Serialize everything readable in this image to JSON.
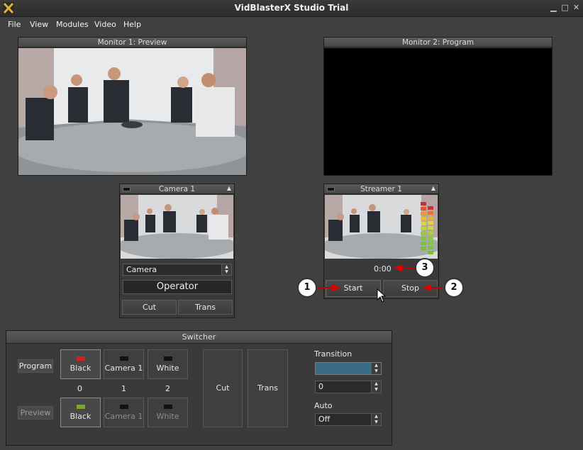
{
  "window": {
    "title": "VidBlasterX Studio Trial"
  },
  "menu": [
    "File",
    "View",
    "Modules",
    "Video",
    "Help"
  ],
  "monitor1": {
    "title": "Monitor 1: Preview"
  },
  "monitor2": {
    "title": "Monitor 2: Program"
  },
  "camera1": {
    "title": "Camera 1",
    "source_select": "Camera",
    "operator": "Operator",
    "cut_label": "Cut",
    "trans_label": "Trans"
  },
  "streamer1": {
    "title": "Streamer 1",
    "time": "0:00",
    "start_label": "Start",
    "stop_label": "Stop"
  },
  "switcher": {
    "title": "Switcher",
    "program_label": "Program",
    "preview_label": "Preview",
    "program_sources": [
      "Black",
      "Camera 1",
      "White"
    ],
    "preview_sources": [
      "Black",
      "Camera 1",
      "White"
    ],
    "indexes": [
      "0",
      "1",
      "2"
    ],
    "cut_label": "Cut",
    "trans_label": "Trans",
    "transition_label": "Transition",
    "transition_value": "",
    "duration_value": "0",
    "auto_label": "Auto",
    "auto_value": "Off",
    "colors": {
      "program_led": "#d42020",
      "preview_led": "#7aa828",
      "transition_fill": "#3b6c87"
    }
  },
  "callouts": [
    "1",
    "2",
    "3"
  ]
}
